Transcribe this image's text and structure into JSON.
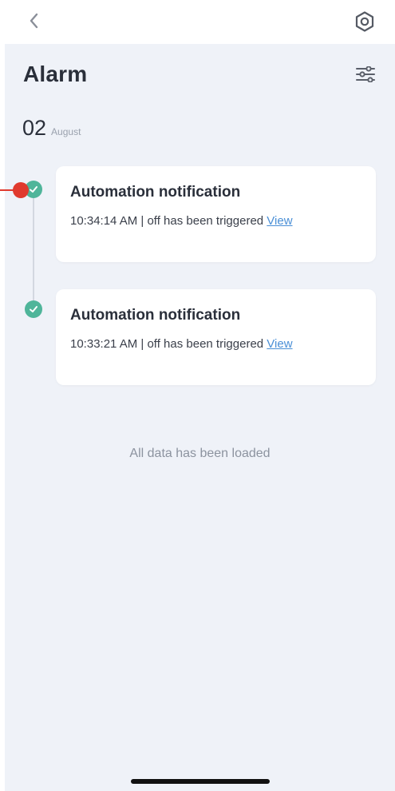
{
  "top_bar": {
    "back_icon": "chevron-left-icon",
    "settings_icon": "gear-icon"
  },
  "page": {
    "title": "Alarm",
    "filter_icon": "filter-lines-icon"
  },
  "date_group": {
    "day": "02",
    "month": "August"
  },
  "notifications": [
    {
      "title": "Automation notification",
      "detail": "10:34:14 AM | off has been triggered ",
      "link": "View",
      "status_icon": "check-circle-icon"
    },
    {
      "title": "Automation notification",
      "detail": "10:33:21 AM | off has been triggered ",
      "link": "View",
      "status_icon": "check-circle-icon"
    }
  ],
  "footer": {
    "loaded_text": "All data has been loaded"
  },
  "colors": {
    "accent_green": "#4fb59a",
    "link_blue": "#4a8fd6",
    "background": "#eff2f8",
    "annotation_red": "#e03a2e"
  }
}
